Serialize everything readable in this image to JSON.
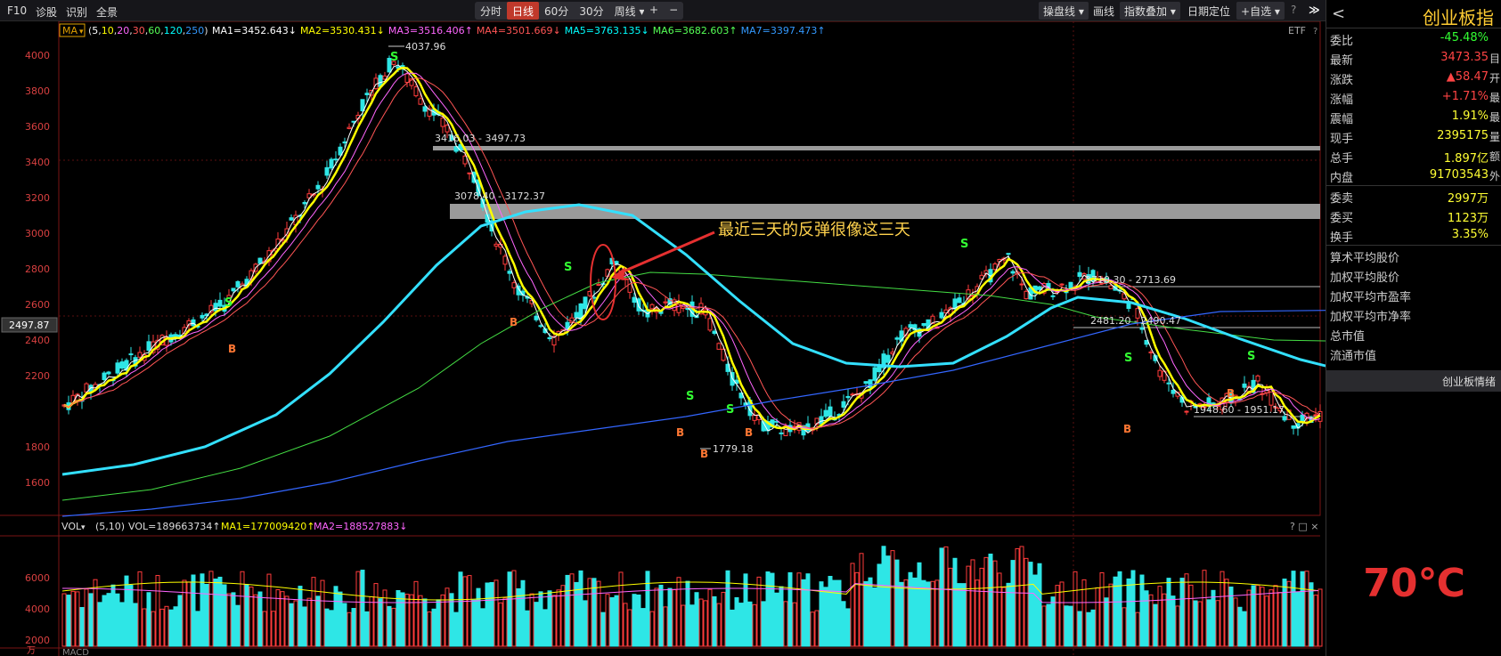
{
  "toolbar": {
    "left_items": [
      "F10",
      "诊股",
      "识别",
      "全景"
    ],
    "period_tabs": [
      "分时",
      "日线",
      "60分",
      "30分",
      "周线"
    ],
    "active_period": "日线",
    "zoom_in": "+",
    "zoom_out": "−",
    "right_items": [
      "操盘线",
      "画线",
      "指数叠加",
      "日期定位",
      "自选"
    ],
    "help": "?",
    "collapse": "≫"
  },
  "ma_legend": {
    "label": "MA",
    "params_prefix": "(",
    "params": [
      {
        "v": "5",
        "color": "#ffffff"
      },
      {
        "v": "10",
        "color": "#ffff00"
      },
      {
        "v": "20",
        "color": "#ff66ff"
      },
      {
        "v": "30",
        "color": "#ff5555"
      },
      {
        "v": "60",
        "color": "#55ff55"
      },
      {
        "v": "120",
        "color": "#00ffff"
      },
      {
        "v": "250",
        "color": "#3399ff"
      }
    ],
    "params_suffix": ")",
    "values": [
      {
        "text": "MA1=3452.643↓",
        "color": "#ffffff"
      },
      {
        "text": "MA2=3530.431↓",
        "color": "#ffff00"
      },
      {
        "text": "MA3=3516.406↑",
        "color": "#ff66ff"
      },
      {
        "text": "MA4=3501.669↓",
        "color": "#ff5555"
      },
      {
        "text": "MA5=3763.135↓",
        "color": "#00ffff"
      },
      {
        "text": "MA6=3682.603↑",
        "color": "#55ff55"
      },
      {
        "text": "MA7=3397.473↑",
        "color": "#3399ff"
      }
    ],
    "etf": "ETF",
    "help": "?"
  },
  "price_axis": {
    "labels": [
      "4000",
      "3800",
      "3600",
      "3400",
      "3200",
      "3000",
      "2800",
      "2600",
      "2400",
      "2200",
      "1800",
      "1600"
    ],
    "current": "2497.87"
  },
  "annotations": {
    "high": "4037.96",
    "low": "1779.18",
    "band1": "3416.03 - 3497.73",
    "band2": "3078.40 - 3172.37",
    "line3": "2710.30 - 2713.69",
    "line4": "2481.20 - 2490.47",
    "line5": "1948.60 - 1951.17",
    "note": "最近三天的反弹很像这三天",
    "signal_s": "S",
    "signal_b": "B"
  },
  "volume": {
    "label": "VOL",
    "params": "(5,10)",
    "vol": "VOL=189663734↑",
    "ma1": "MA1=177009420↑",
    "ma2": "MA2=188527883↓",
    "axis_labels": [
      "6000",
      "4000",
      "2000"
    ],
    "unit": "万",
    "controls": "? □ ×"
  },
  "macd": {
    "label": "MACD"
  },
  "panel": {
    "title": "创业板指",
    "back": "<",
    "rows": [
      {
        "label": "委比",
        "value": "-45.48%",
        "color": "#33ff33",
        "edge": ""
      },
      {
        "label": "最新",
        "value": "3473.35",
        "color": "#ff4444",
        "edge": "目"
      },
      {
        "label": "涨跌",
        "value": "▲58.47",
        "color": "#ff4444",
        "edge": "开"
      },
      {
        "label": "涨幅",
        "value": "+1.71%",
        "color": "#ff4444",
        "edge": "最"
      },
      {
        "label": "震幅",
        "value": "1.91%",
        "color": "#ffff33",
        "edge": "最"
      },
      {
        "label": "现手",
        "value": "2395175",
        "color": "#ffff33",
        "edge": "量"
      },
      {
        "label": "总手",
        "value": "1.897亿",
        "color": "#ffff33",
        "edge": "额"
      },
      {
        "label": "内盘",
        "value": "91703543",
        "color": "#ffff33",
        "edge": "外"
      }
    ],
    "rows2": [
      {
        "label": "委卖",
        "value": "2997万",
        "color": "#ffff33"
      },
      {
        "label": "委买",
        "value": "1123万",
        "color": "#ffff33"
      },
      {
        "label": "换手",
        "value": "3.35%",
        "color": "#ffff33"
      }
    ],
    "links": [
      "算术平均股价",
      "加权平均股价",
      "加权平均市盈率",
      "加权平均市净率",
      "总市值",
      "流通市值"
    ],
    "sentiment_tab": "创业板情绪",
    "temperature": "70℃"
  },
  "chart_data": {
    "type": "candlestick",
    "ylim": [
      1450,
      4100
    ],
    "ma120_points": [
      [
        0,
        1665
      ],
      [
        80,
        1720
      ],
      [
        160,
        1820
      ],
      [
        240,
        2000
      ],
      [
        300,
        2230
      ],
      [
        360,
        2520
      ],
      [
        420,
        2840
      ],
      [
        470,
        3060
      ],
      [
        520,
        3140
      ],
      [
        580,
        3180
      ],
      [
        640,
        3120
      ],
      [
        700,
        2900
      ],
      [
        760,
        2640
      ],
      [
        820,
        2400
      ],
      [
        880,
        2290
      ],
      [
        940,
        2270
      ],
      [
        1000,
        2290
      ],
      [
        1060,
        2440
      ],
      [
        1110,
        2600
      ],
      [
        1140,
        2660
      ],
      [
        1200,
        2630
      ],
      [
        1260,
        2540
      ],
      [
        1320,
        2430
      ],
      [
        1390,
        2310
      ],
      [
        1478,
        2200
      ]
    ],
    "ma60_points": [
      [
        0,
        1520
      ],
      [
        100,
        1580
      ],
      [
        200,
        1700
      ],
      [
        300,
        1880
      ],
      [
        400,
        2150
      ],
      [
        470,
        2400
      ],
      [
        540,
        2600
      ],
      [
        600,
        2740
      ],
      [
        660,
        2800
      ],
      [
        720,
        2790
      ],
      [
        800,
        2760
      ],
      [
        880,
        2730
      ],
      [
        960,
        2700
      ],
      [
        1040,
        2670
      ],
      [
        1110,
        2620
      ],
      [
        1160,
        2550
      ],
      [
        1260,
        2480
      ],
      [
        1360,
        2420
      ],
      [
        1478,
        2410
      ]
    ],
    "ma250_points": [
      [
        0,
        1430
      ],
      [
        100,
        1470
      ],
      [
        200,
        1530
      ],
      [
        300,
        1620
      ],
      [
        400,
        1740
      ],
      [
        500,
        1850
      ],
      [
        600,
        1920
      ],
      [
        700,
        1990
      ],
      [
        800,
        2080
      ],
      [
        900,
        2160
      ],
      [
        1000,
        2250
      ],
      [
        1100,
        2380
      ],
      [
        1200,
        2510
      ],
      [
        1300,
        2580
      ],
      [
        1478,
        2590
      ]
    ],
    "volume_range": [
      0,
      7000
    ]
  }
}
